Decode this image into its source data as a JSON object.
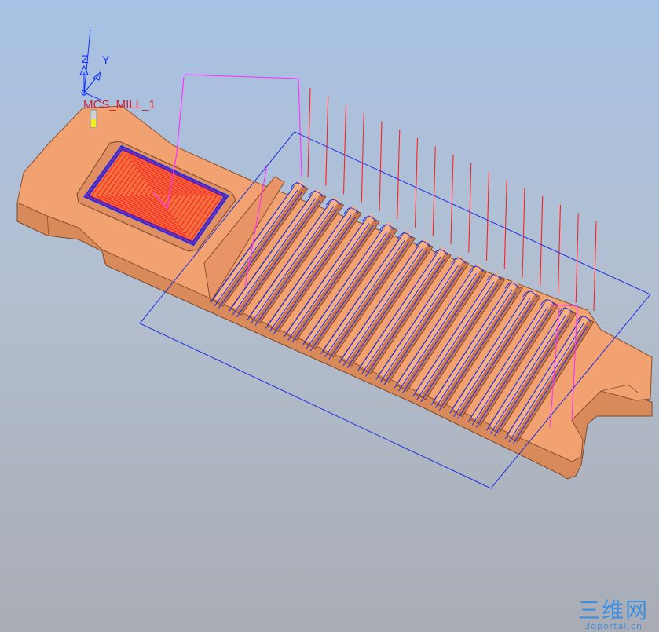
{
  "viewport": {
    "name": "cam-graphics-window",
    "background_top": "#a7c1e4",
    "background_bottom": "#a9acb4"
  },
  "csys": {
    "label": "MCS_MILL_1",
    "axis_z_label": "Z",
    "axis_y_label": "Y"
  },
  "part": {
    "face_color": "#f2a270",
    "side_color": "#d98a5a"
  },
  "toolpath": {
    "cut_color": "#ff2020",
    "engage_color": "#1030ff",
    "non_cut_color": "#ff30ff",
    "fin_passes": 17
  },
  "watermark": {
    "title": "三维网",
    "subtitle": "3dportal.cn"
  }
}
